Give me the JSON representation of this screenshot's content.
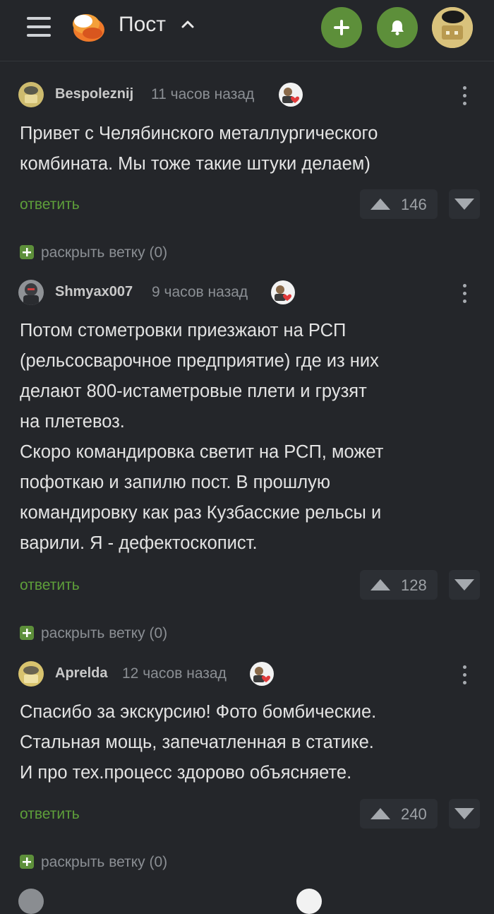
{
  "header": {
    "title": "Пост",
    "menu_icon": "hamburger-icon",
    "logo_icon": "pikabu-logo-icon",
    "caret_icon": "chevron-up-icon",
    "add_icon": "plus-icon",
    "notify_icon": "bell-icon",
    "profile_icon": "user-avatar",
    "accent": "#5d8f3a"
  },
  "comments": [
    {
      "user": "Bespoleznij",
      "time": "11 часов назад",
      "text": "Привет с Челябинского металлургического\nкомбината. Мы тоже такие штуки делаем)",
      "reply": "ответить",
      "rating": "146",
      "expand": "раскрыть ветку (0)"
    },
    {
      "user": "Shmyax007",
      "time": "9 часов назад",
      "text": "Потом стометровки приезжают на РСП\n(рельсосварочное предприятие) где из них\nделают 800-истаметровые плети и грузят\nна плетевоз.\nСкоро командировка светит на РСП, может\nпофоткаю и запилю пост. В прошлую\nкомандировку как раз Кузбасские рельсы и\nварили. Я - дефектоскопист.",
      "reply": "ответить",
      "rating": "128",
      "expand": "раскрыть ветку (0)"
    },
    {
      "user": "Aprelda",
      "time": "12 часов назад",
      "text": "Спасибо за экскурсию! Фото бомбические.\nСтальная мощь, запечатленная в статике.\nИ про тех.процесс здорово объясняете.",
      "reply": "ответить",
      "rating": "240",
      "expand": "раскрыть ветку (0)"
    }
  ]
}
